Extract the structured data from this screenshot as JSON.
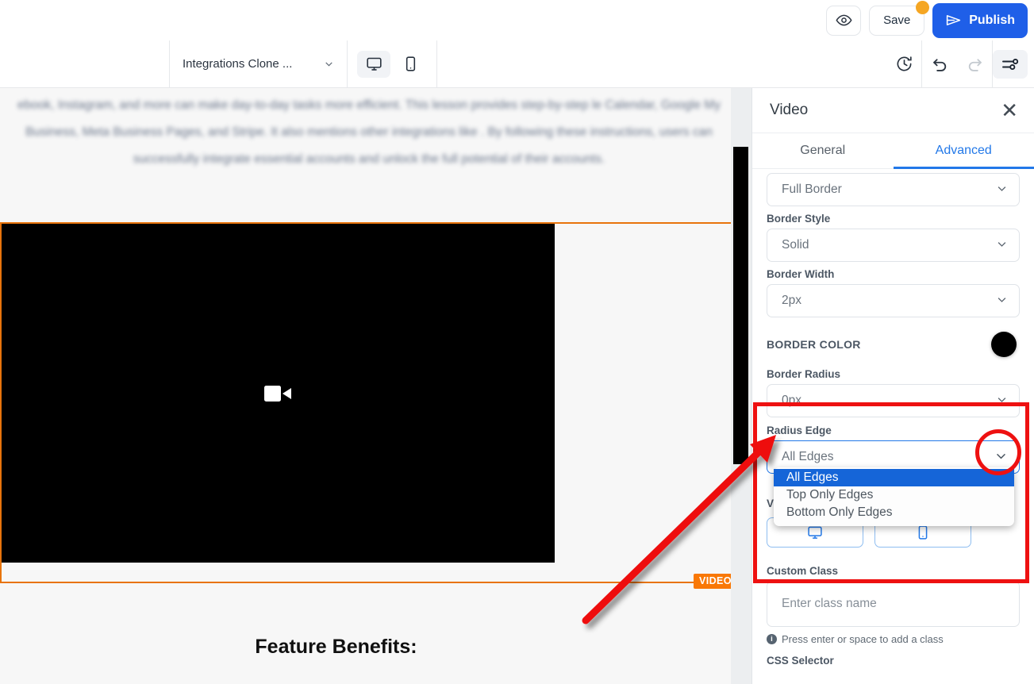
{
  "topbar": {
    "preview_title": "Preview",
    "save_label": "Save",
    "publish_label": "Publish",
    "has_unsaved_badge": true
  },
  "secondbar": {
    "page_name": "Integrations Clone ...",
    "devices": [
      {
        "name": "desktop",
        "active": true
      },
      {
        "name": "mobile",
        "active": false
      }
    ],
    "history_title": "Revision History",
    "undo_title": "Undo",
    "redo_title": "Redo",
    "preferences_title": "Preferences"
  },
  "canvas": {
    "intro_paragraph": "ebook, Instagram, and more can make day-to-day tasks more efficient. This lesson provides step-by-step le Calendar, Google My Business, Meta Business Pages, and Stripe. It also mentions other integrations like . By following these instructions, users can successfully integrate essential accounts and unlock the full potential of their accounts.",
    "video_block_badge": "VIDEO",
    "feature_heading": "Feature Benefits:"
  },
  "panel": {
    "title": "Video",
    "close_label": "✕",
    "tabs": [
      {
        "label": "General",
        "active": false
      },
      {
        "label": "Advanced",
        "active": true
      }
    ],
    "fields": {
      "border_type_value": "Full Border",
      "border_style_label": "Border Style",
      "border_style_value": "Solid",
      "border_width_label": "Border Width",
      "border_width_value": "2px",
      "border_color_label": "BORDER COLOR",
      "border_color_value": "#000000",
      "border_radius_label": "Border Radius",
      "border_radius_value": "0px",
      "radius_edge_label": "Radius Edge",
      "radius_edge_value": "All Edges",
      "visibility_label": "Vis",
      "custom_class_label": "Custom Class",
      "custom_class_placeholder": "Enter class name",
      "custom_class_hint": "Press enter or space to add a class",
      "css_selector_label": "CSS Selector"
    },
    "radius_edge_options": [
      {
        "label": "All Edges",
        "selected": true
      },
      {
        "label": "Top Only Edges",
        "selected": false
      },
      {
        "label": "Bottom Only Edges",
        "selected": false
      }
    ]
  },
  "colors": {
    "accent_blue": "#1f5fe8",
    "tab_blue": "#2278e8",
    "dropdown_selected": "#1565d8",
    "annotation_red": "#ee1111",
    "selection_orange": "#e8740c",
    "badge_orange": "#f97806",
    "save_badge": "#f5a623"
  }
}
